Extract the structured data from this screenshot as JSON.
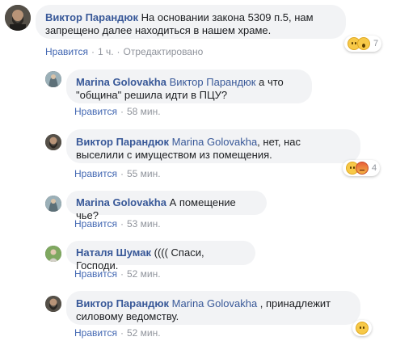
{
  "comments": [
    {
      "author": "Виктор Парандюк",
      "mention": "",
      "text": "На основании закона 5309 п.5, нам запрещено далее находиться в нашем храме.",
      "like": "Нравится",
      "time": "1 ч.",
      "edited": "Отредактировано",
      "reactions": [
        "sad-emoji",
        "wow-emoji"
      ],
      "reaction_count": "7"
    },
    {
      "author": "Marina Golovakha",
      "mention": "Виктор Парандюк",
      "text": "а что \"община\" решила идти в ПЦУ?",
      "like": "Нравится",
      "time": "58 мин."
    },
    {
      "author": "Виктор Парандюк",
      "mention": "Marina Golovakha",
      "text": ", нет, нас выселили с имуществом из помещения.",
      "like": "Нравится",
      "time": "55 мин.",
      "reactions": [
        "sad-emoji",
        "angry-emoji"
      ],
      "reaction_count": "4"
    },
    {
      "author": "Marina Golovakha",
      "mention": "",
      "text": "А помещение чье?",
      "like": "Нравится",
      "time": "53 мин."
    },
    {
      "author": "Наталя Шумак",
      "mention": "",
      "text": "(((( Спаси, Господи.",
      "like": "Нравится",
      "time": "52 мин."
    },
    {
      "author": "Виктор Парандюк",
      "mention": "Marina Golovakha",
      "text": ", принадлежит силовому ведомству.",
      "like": "Нравится",
      "time": "52 мин.",
      "reactions": [
        "sad-emoji"
      ]
    }
  ],
  "colors": {
    "link": "#385898",
    "like": "#4267b2",
    "meta": "#90949c",
    "bubble": "#f2f3f5"
  }
}
